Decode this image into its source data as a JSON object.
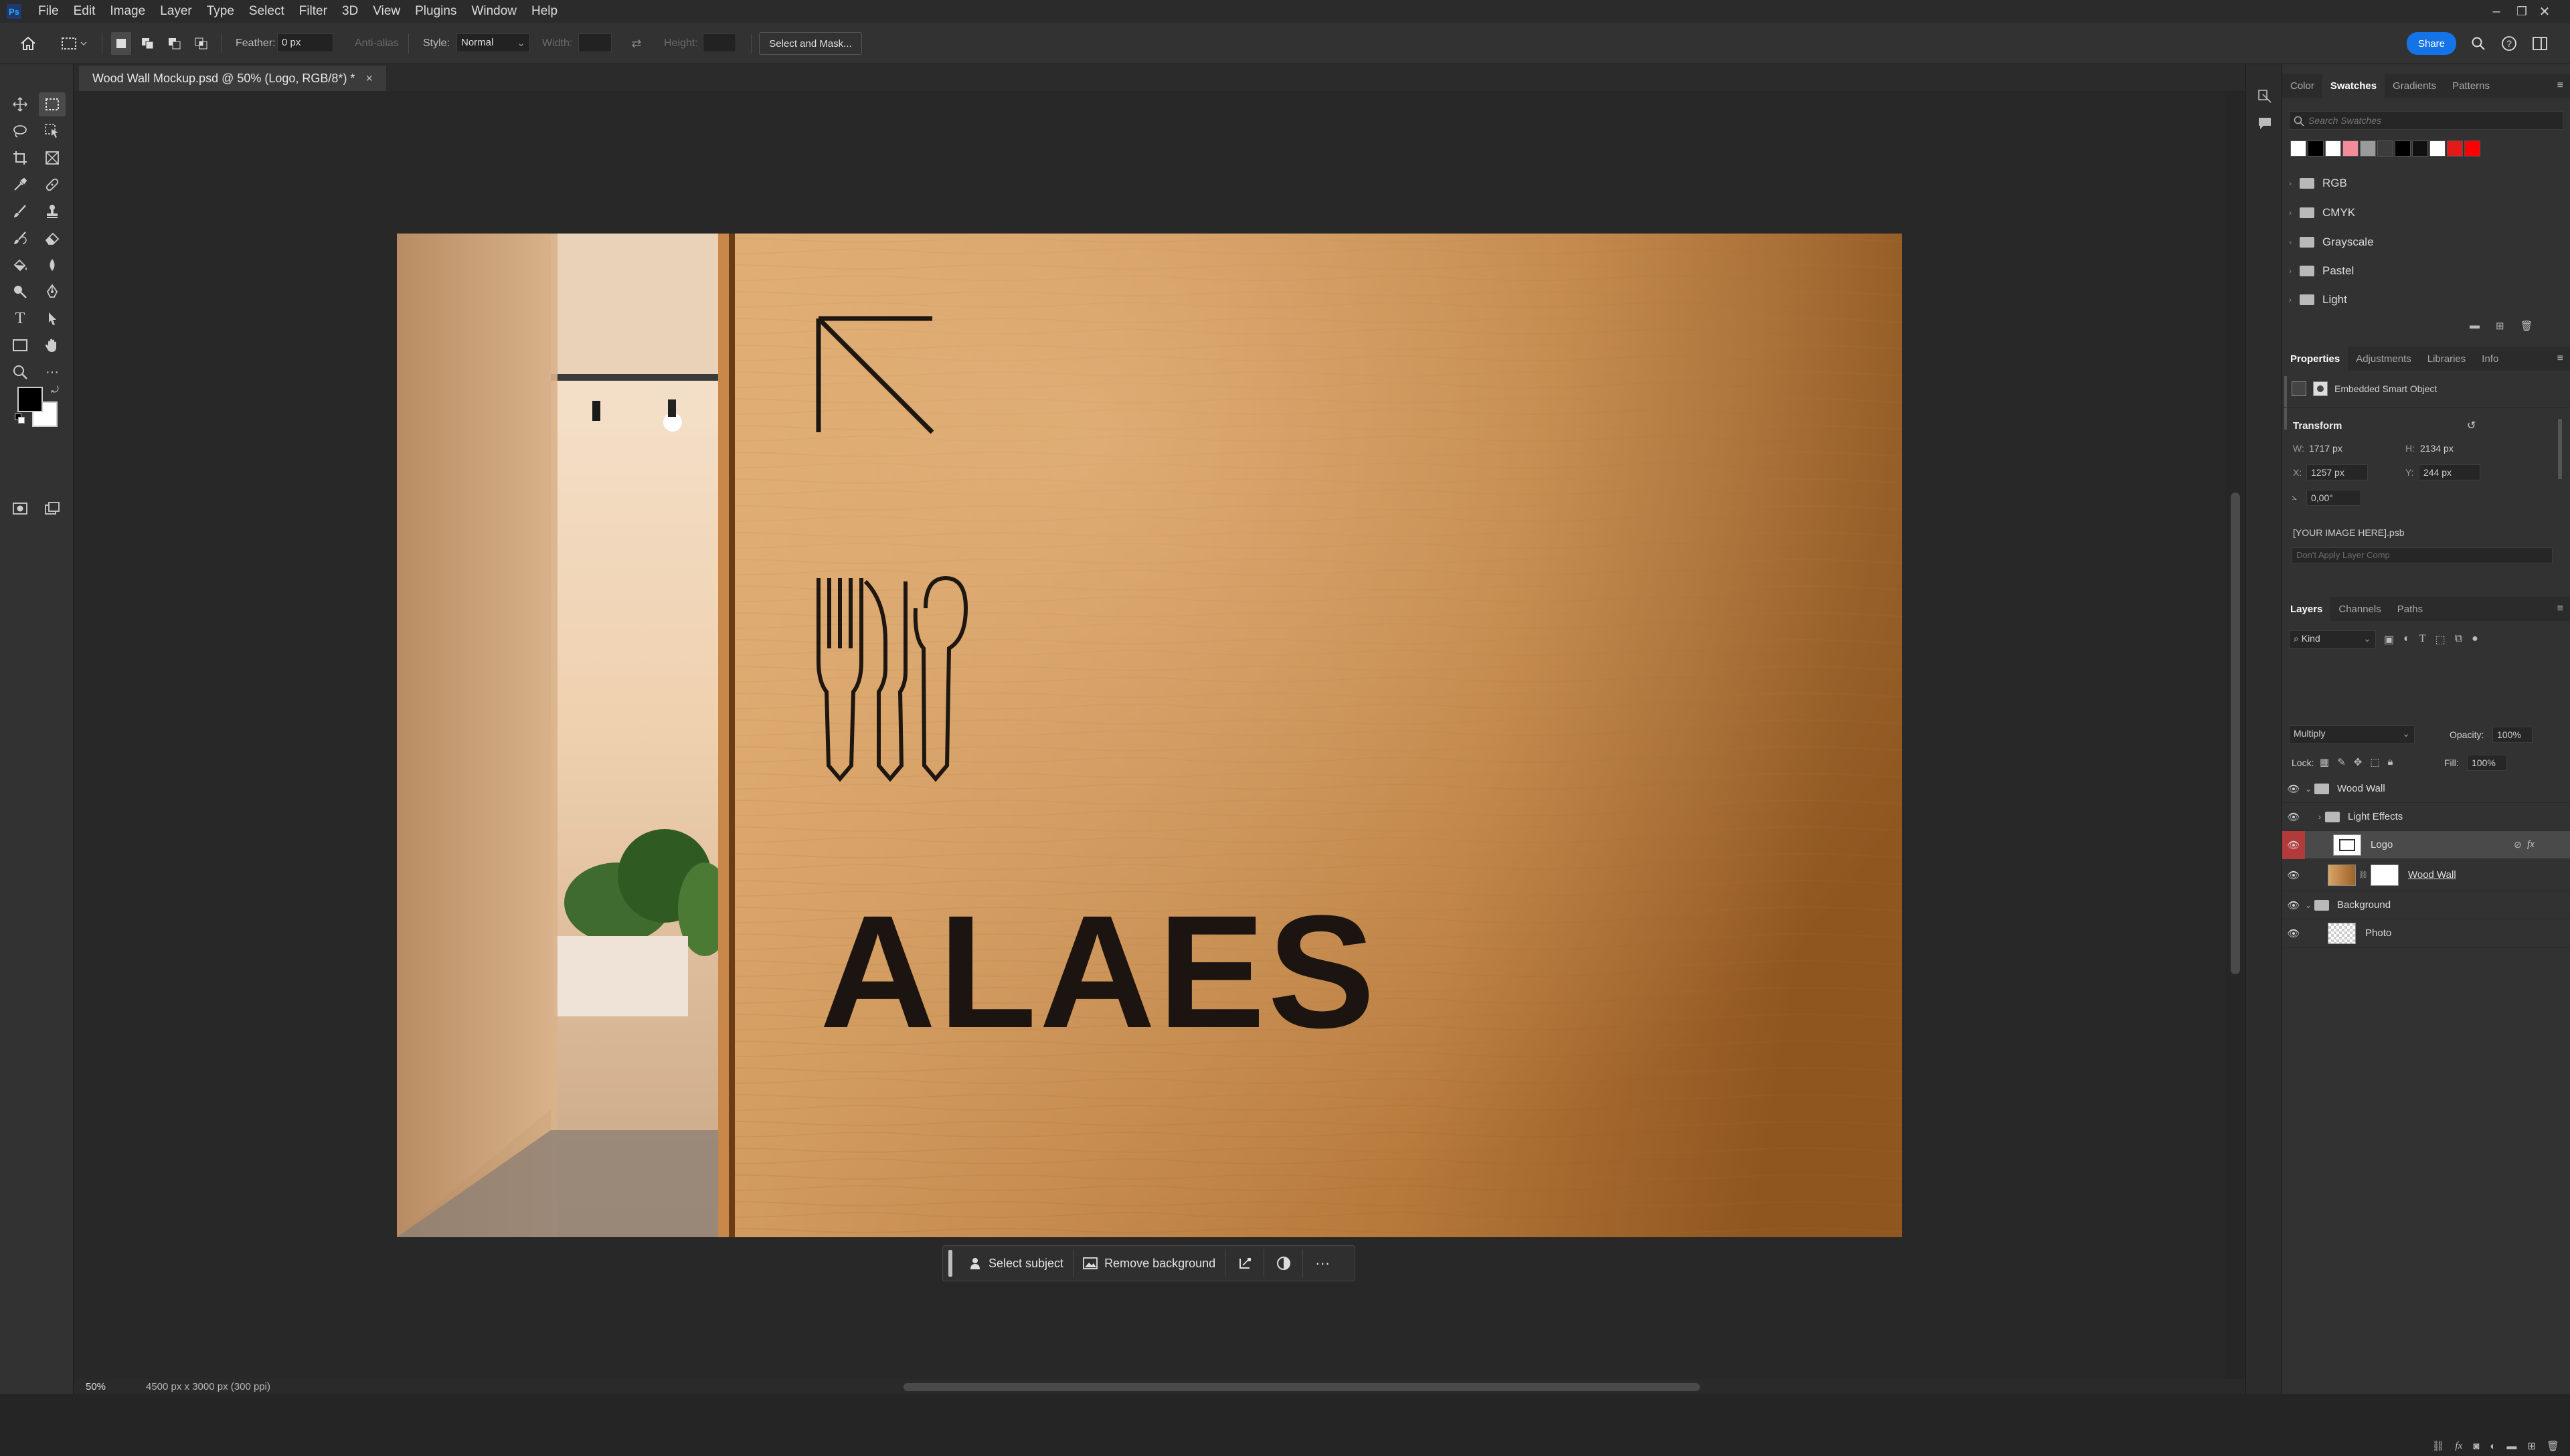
{
  "app": {
    "logo": "Ps"
  },
  "menu": [
    "File",
    "Edit",
    "Image",
    "Layer",
    "Type",
    "Select",
    "Filter",
    "3D",
    "View",
    "Plugins",
    "Window",
    "Help"
  ],
  "window_controls": {
    "minimize": "–",
    "restore": "❐",
    "close": "✕"
  },
  "options_bar": {
    "feather_label": "Feather:",
    "feather_value": "0 px",
    "antialias_label": "Anti-alias",
    "style_label": "Style:",
    "style_value": "Normal",
    "width_label": "Width:",
    "height_label": "Height:",
    "select_mask_label": "Select and Mask...",
    "share_label": "Share"
  },
  "document": {
    "tab_title": "Wood Wall Mockup.psd @ 50% (Logo, RGB/8*) *",
    "close": "×",
    "zoom": "50%",
    "doc_info": "4500 px x 3000 px (300 ppi)"
  },
  "artwork": {
    "brand_text": "ALAES"
  },
  "contextual_bar": {
    "select_subject": "Select subject",
    "remove_background": "Remove background",
    "more": "···"
  },
  "swatches_panel": {
    "tabs": [
      "Color",
      "Swatches",
      "Gradients",
      "Patterns"
    ],
    "active_tab": "Swatches",
    "search_placeholder": "Search Swatches",
    "recent_colors": [
      "#ffffff",
      "#000000",
      "#ffffff",
      "#f28b9a",
      "#9a9a9a",
      "#3c3c3c",
      "#000000",
      "#101010",
      "#ffffff",
      "#e21a1a",
      "#ff0000"
    ],
    "groups": [
      "RGB",
      "CMYK",
      "Grayscale",
      "Pastel",
      "Light"
    ]
  },
  "properties_panel": {
    "tabs": [
      "Properties",
      "Adjustments",
      "Libraries",
      "Info"
    ],
    "active_tab": "Properties",
    "object_type": "Embedded Smart Object",
    "transform_label": "Transform",
    "w_label": "W:",
    "w_value": "1717 px",
    "h_label": "H:",
    "h_value": "2134 px",
    "x_label": "X:",
    "x_value": "1257 px",
    "y_label": "Y:",
    "y_value": "244 px",
    "angle_value": "0,00°",
    "linked_file": "[YOUR IMAGE HERE].psb",
    "layer_comp": "Don't Apply Layer Comp"
  },
  "layers_panel": {
    "tabs": [
      "Layers",
      "Channels",
      "Paths"
    ],
    "active_tab": "Layers",
    "kind_label": "Kind",
    "blend_mode": "Multiply",
    "opacity_label": "Opacity:",
    "opacity_value": "100%",
    "lock_label": "Lock:",
    "fill_label": "Fill:",
    "fill_value": "100%",
    "layers": [
      {
        "name": "Wood Wall",
        "type": "group",
        "expanded": true
      },
      {
        "name": "Light Effects",
        "type": "group",
        "expanded": false
      },
      {
        "name": "Logo",
        "type": "smart-object",
        "selected": true,
        "fx": "fx"
      },
      {
        "name": "Wood Wall",
        "type": "layer-with-mask"
      },
      {
        "name": "Background",
        "type": "group",
        "expanded": true
      },
      {
        "name": "Photo",
        "type": "layer"
      }
    ]
  },
  "colors": {
    "accent": "#1473e6",
    "wood": "#c98f52",
    "selected_eye": "#b13b3b"
  }
}
